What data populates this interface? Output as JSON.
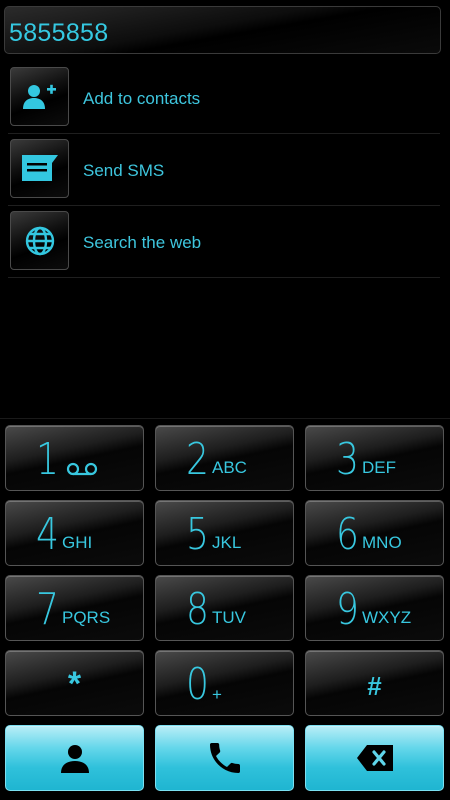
{
  "display": {
    "number": "5855858"
  },
  "suggestions": [
    {
      "label": "Add to contacts",
      "icon": "add-contact-icon"
    },
    {
      "label": "Send SMS",
      "icon": "message-icon"
    },
    {
      "label": "Search the web",
      "icon": "globe-icon"
    }
  ],
  "keypad": {
    "keys": [
      {
        "digit": "1",
        "letters": ""
      },
      {
        "digit": "2",
        "letters": "ABC"
      },
      {
        "digit": "3",
        "letters": "DEF"
      },
      {
        "digit": "4",
        "letters": "GHI"
      },
      {
        "digit": "5",
        "letters": "JKL"
      },
      {
        "digit": "6",
        "letters": "MNO"
      },
      {
        "digit": "7",
        "letters": "PQRS"
      },
      {
        "digit": "8",
        "letters": "TUV"
      },
      {
        "digit": "9",
        "letters": "WXYZ"
      },
      {
        "digit": "*",
        "letters": ""
      },
      {
        "digit": "0",
        "letters": "+"
      },
      {
        "digit": "#",
        "letters": ""
      }
    ]
  },
  "actions": {
    "contacts_icon": "person-icon",
    "call_icon": "phone-icon",
    "delete_icon": "backspace-icon"
  },
  "colors": {
    "accent": "#33c7e0",
    "background": "#000000",
    "action_button": "#2fc1db"
  }
}
